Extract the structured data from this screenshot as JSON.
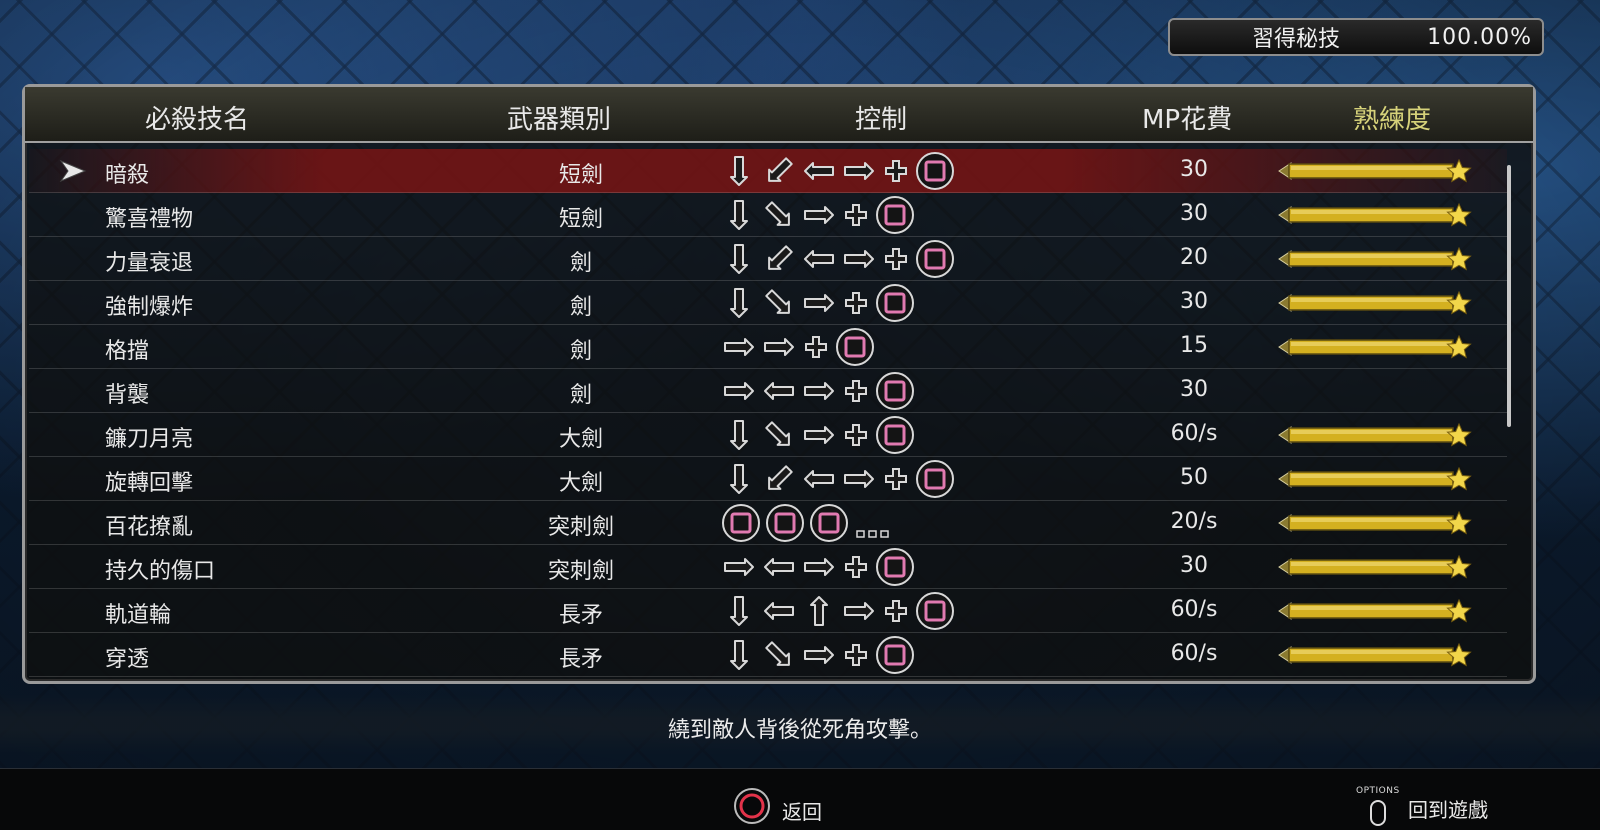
{
  "mastery": {
    "label": "習得秘技",
    "value": "100.00%"
  },
  "headers": {
    "name": "必殺技名",
    "weapon": "武器類別",
    "control": "控制",
    "mp": "MP花費",
    "mastery": "熟練度"
  },
  "skills": [
    {
      "name": "暗殺",
      "weapon": "短劍",
      "mp": "30",
      "inputs": [
        "down",
        "down-left",
        "left",
        "right",
        "plus",
        "square"
      ],
      "mastered": true,
      "selected": true
    },
    {
      "name": "驚喜禮物",
      "weapon": "短劍",
      "mp": "30",
      "inputs": [
        "down",
        "down-right",
        "right",
        "plus",
        "square"
      ],
      "mastered": true
    },
    {
      "name": "力量衰退",
      "weapon": "劍",
      "mp": "20",
      "inputs": [
        "down",
        "down-left",
        "left",
        "right",
        "plus",
        "square"
      ],
      "mastered": true
    },
    {
      "name": "強制爆炸",
      "weapon": "劍",
      "mp": "30",
      "inputs": [
        "down",
        "down-right",
        "right",
        "plus",
        "square"
      ],
      "mastered": true
    },
    {
      "name": "格擋",
      "weapon": "劍",
      "mp": "15",
      "inputs": [
        "right",
        "right",
        "plus",
        "square"
      ],
      "mastered": true
    },
    {
      "name": "背襲",
      "weapon": "劍",
      "mp": "30",
      "inputs": [
        "right",
        "left",
        "right",
        "plus",
        "square"
      ],
      "mastered": false
    },
    {
      "name": "鐮刀月亮",
      "weapon": "大劍",
      "mp": "60/s",
      "inputs": [
        "down",
        "down-right",
        "right",
        "plus",
        "square"
      ],
      "mastered": true
    },
    {
      "name": "旋轉回擊",
      "weapon": "大劍",
      "mp": "50",
      "inputs": [
        "down",
        "down-left",
        "left",
        "right",
        "plus",
        "square"
      ],
      "mastered": true
    },
    {
      "name": "百花撩亂",
      "weapon": "突刺劍",
      "mp": "20/s",
      "inputs": [
        "square",
        "square",
        "square",
        "dots"
      ],
      "mastered": true
    },
    {
      "name": "持久的傷口",
      "weapon": "突刺劍",
      "mp": "30",
      "inputs": [
        "right",
        "left",
        "right",
        "plus",
        "square"
      ],
      "mastered": true
    },
    {
      "name": "軌道輪",
      "weapon": "長矛",
      "mp": "60/s",
      "inputs": [
        "down",
        "left",
        "up",
        "right",
        "plus",
        "square"
      ],
      "mastered": true
    },
    {
      "name": "穿透",
      "weapon": "長矛",
      "mp": "60/s",
      "inputs": [
        "down",
        "down-right",
        "right",
        "plus",
        "square"
      ],
      "mastered": true
    }
  ],
  "description": "繞到敵人背後從死角攻擊。",
  "footer": {
    "back_label": "返回",
    "options_caption": "OPTIONS",
    "return_label": "回到遊戲"
  },
  "colors": {
    "selected_row": "#7a1414",
    "mastery_bar": "#d4b020",
    "star": "#f2d64a",
    "square_button": "#e27ab0",
    "circle_button": "#e2334a"
  }
}
